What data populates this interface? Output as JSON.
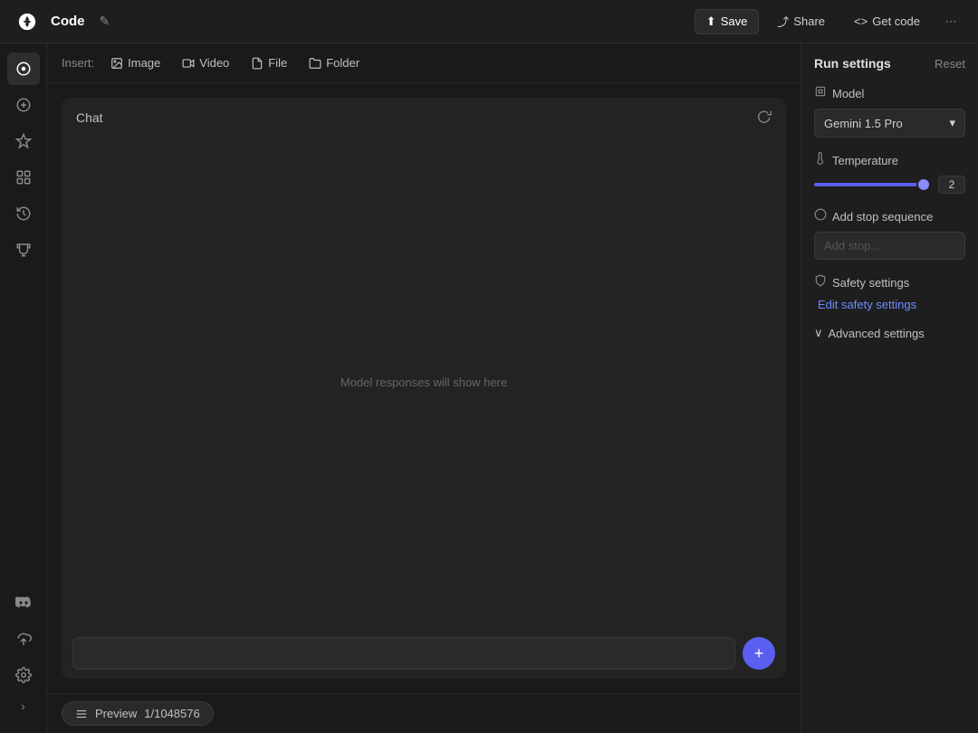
{
  "topbar": {
    "title": "Code",
    "save_label": "Save",
    "share_label": "Share",
    "get_code_label": "Get code"
  },
  "insert_bar": {
    "label": "Insert:",
    "image_label": "Image",
    "video_label": "Video",
    "file_label": "File",
    "folder_label": "Folder"
  },
  "chat": {
    "title": "Chat",
    "placeholder": "Model responses will show here",
    "input_placeholder": ""
  },
  "run_settings": {
    "title": "Run settings",
    "reset_label": "Reset",
    "model_label": "Model",
    "model_value": "Gemini 1.5 Pro",
    "temperature_label": "Temperature",
    "temperature_value": "2",
    "stop_sequence_label": "Add stop sequence",
    "stop_input_placeholder": "Add stop...",
    "safety_label": "Safety settings",
    "safety_link_label": "Edit safety settings",
    "advanced_label": "Advanced settings"
  },
  "bottom_bar": {
    "preview_label": "Preview",
    "preview_count": "1/1048576"
  },
  "sidebar": {
    "icons": [
      {
        "name": "logo-icon",
        "symbol": "✦"
      },
      {
        "name": "plus-circle-icon",
        "symbol": "⊕"
      },
      {
        "name": "sparkle-icon",
        "symbol": "✧"
      },
      {
        "name": "grid-icon",
        "symbol": "⊞"
      },
      {
        "name": "history-icon",
        "symbol": "⟳"
      },
      {
        "name": "trophy-icon",
        "symbol": "⬡"
      },
      {
        "name": "discord-icon",
        "symbol": "⬡"
      }
    ]
  }
}
